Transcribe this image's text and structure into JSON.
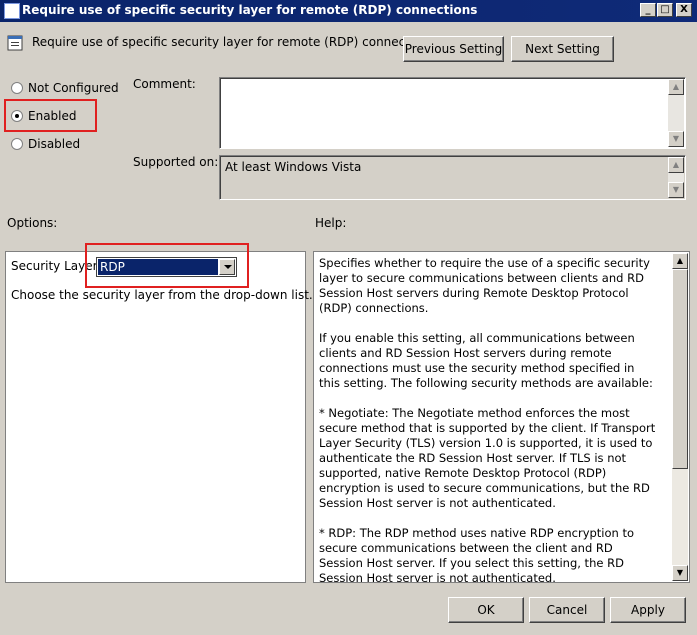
{
  "window": {
    "title": "Require use of specific security layer for remote (RDP) connections",
    "minimize": "_",
    "maximize": "□",
    "close": "X"
  },
  "header": {
    "setting_name": "Require use of specific security layer for remote (RDP) connections",
    "prev_button": "Previous Setting",
    "next_button": "Next Setting"
  },
  "state": {
    "options": [
      {
        "label": "Not Configured",
        "checked": false
      },
      {
        "label": "Enabled",
        "checked": true
      },
      {
        "label": "Disabled",
        "checked": false
      }
    ]
  },
  "comment": {
    "label": "Comment:",
    "value": ""
  },
  "supported": {
    "label": "Supported on:",
    "value": "At least Windows Vista"
  },
  "options_section": {
    "label": "Options:",
    "security_layer_label": "Security Layer",
    "security_layer_value": "RDP",
    "instruction": "Choose the security layer from the drop-down list."
  },
  "help_section": {
    "label": "Help:",
    "paragraphs": [
      "Specifies whether to require the use of a specific security layer to secure communications between clients and RD Session Host servers during Remote Desktop Protocol (RDP) connections.",
      "If you enable this setting, all communications between clients and RD Session Host servers during remote connections must use the security method specified in this setting. The following security methods are available:",
      "* Negotiate: The Negotiate method enforces the most secure method that is supported by the client. If Transport Layer Security (TLS) version 1.0 is supported, it is used to authenticate the RD Session Host server. If TLS is not supported, native Remote Desktop Protocol (RDP) encryption is used to secure communications, but the RD Session Host server is not authenticated.",
      "* RDP: The RDP method uses native RDP encryption to secure communications between the client and RD Session Host server. If you select this setting, the RD Session Host server is not authenticated."
    ]
  },
  "footer": {
    "ok": "OK",
    "cancel": "Cancel",
    "apply": "Apply"
  },
  "colors": {
    "title_bar": "#0a246a",
    "highlight_box": "#e02020",
    "dialog_bg": "#d4d0c8"
  }
}
